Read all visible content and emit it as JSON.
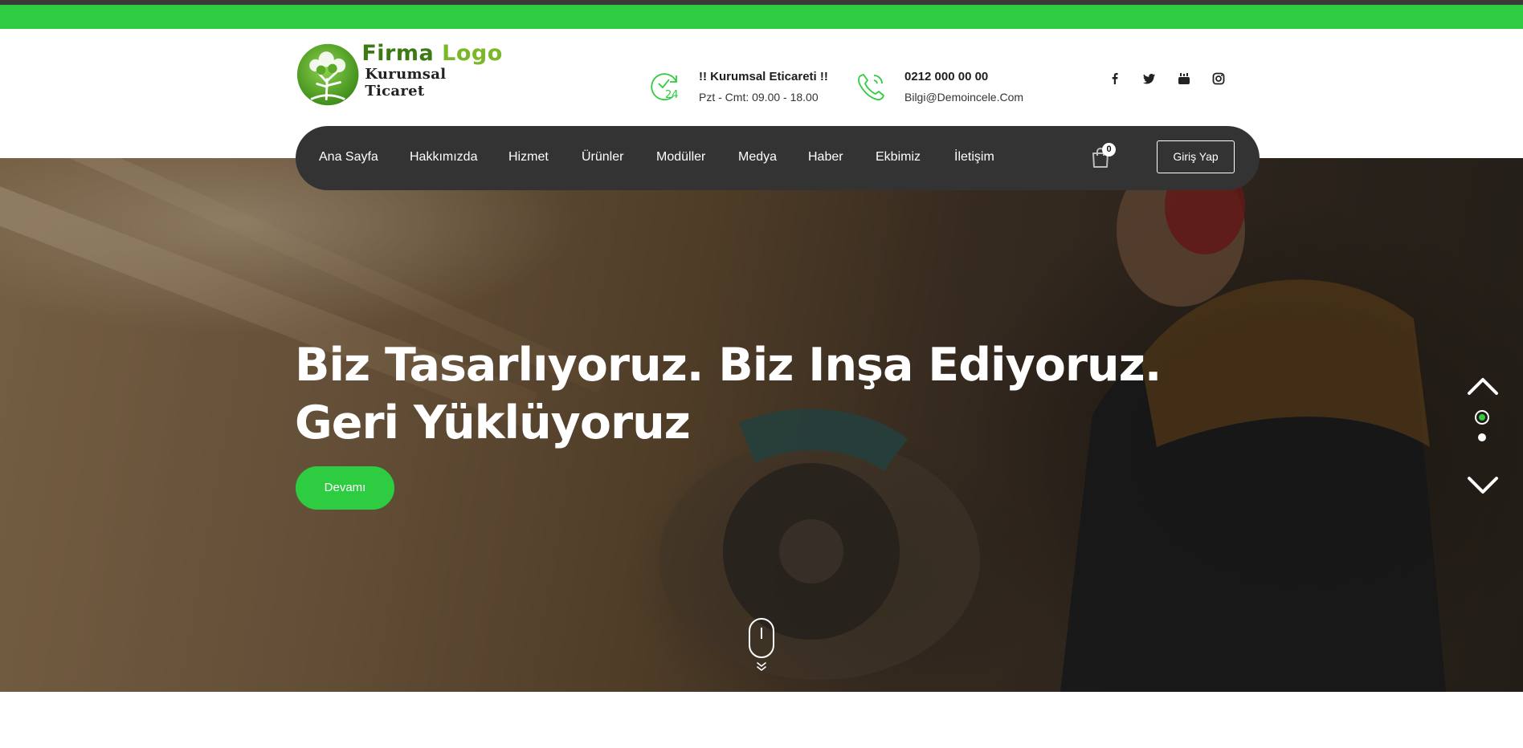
{
  "brand": {
    "name_part1": "Firma",
    "name_part2": "Logo",
    "tagline": "Kurumsal Ticaret",
    "colors": {
      "green": "#2ecc40",
      "logo_dark_green": "#3c7a14",
      "logo_light_green": "#7ab829",
      "nav_bg": "#333333"
    }
  },
  "header_info": [
    {
      "icon": "clock-24-icon",
      "title": "!! Kurumsal Eticareti !!",
      "subtitle": "Pzt - Cmt: 09.00 - 18.00"
    },
    {
      "icon": "phone-icon",
      "title": "0212 000 00 00",
      "subtitle": "Bilgi@Demoincele.Com"
    }
  ],
  "social": [
    {
      "icon": "facebook-icon",
      "glyph": "f"
    },
    {
      "icon": "twitter-icon",
      "glyph": "🐦"
    },
    {
      "icon": "youtube-icon",
      "glyph": "▶"
    },
    {
      "icon": "instagram-icon",
      "glyph": "◎"
    }
  ],
  "nav": {
    "items": [
      "Ana Sayfa",
      "Hakkımızda",
      "Hizmet",
      "Ürünler",
      "Modüller",
      "Medya",
      "Haber",
      "Ekbimiz",
      "İletişim"
    ],
    "cart_icon": "shopping-bag-icon",
    "cart_count": "0",
    "login_label": "Giriş Yap"
  },
  "hero": {
    "title_line1": "Biz Tasarlıyoruz. Biz Inşa Ediyoruz.",
    "title_line2": "Geri Yüklüyoruz",
    "button_label": "Devamı",
    "slides_total": 2,
    "slide_active": 1
  }
}
